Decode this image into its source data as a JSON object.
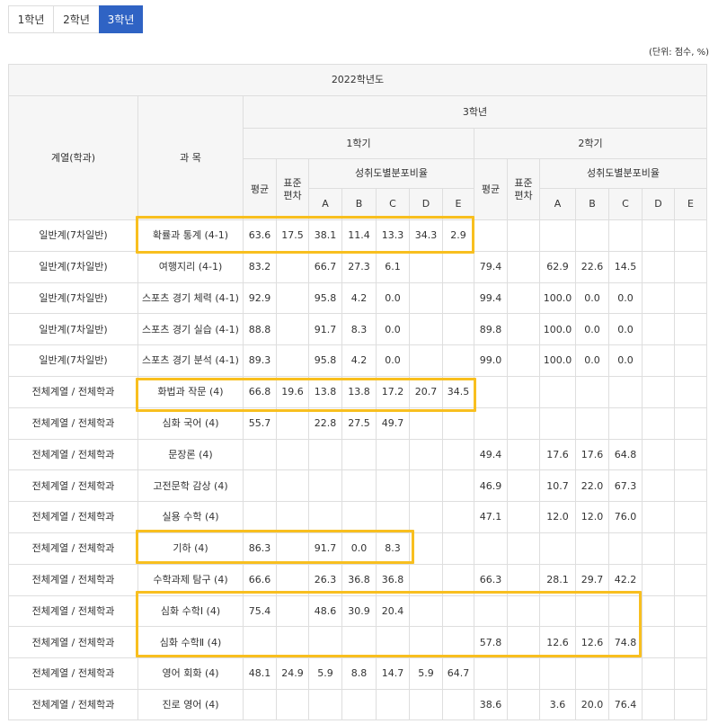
{
  "tabs": [
    {
      "label": "1학년",
      "active": false
    },
    {
      "label": "2학년",
      "active": false
    },
    {
      "label": "3학년",
      "active": true
    }
  ],
  "unit_note": "(단위: 점수, %)",
  "table": {
    "header": {
      "year": "2022학년도",
      "grade": "3학년",
      "dept": "계열(학과)",
      "subject": "과 목",
      "sem1": "1학기",
      "sem2": "2학기",
      "avg": "평균",
      "std_line1": "표준",
      "std_line2": "편차",
      "dist": "성취도별분포비율",
      "grades": [
        "A",
        "B",
        "C",
        "D",
        "E"
      ]
    },
    "rows": [
      {
        "dept": "일반계(7차일반)",
        "subject": "확률과 통계 (4-1)",
        "cells": [
          "63.6",
          "17.5",
          "38.1",
          "11.4",
          "13.3",
          "34.3",
          "2.9",
          "",
          "",
          "",
          "",
          "",
          "",
          ""
        ]
      },
      {
        "dept": "일반계(7차일반)",
        "subject": "여행지리 (4-1)",
        "cells": [
          "83.2",
          "",
          "66.7",
          "27.3",
          "6.1",
          "",
          "",
          "79.4",
          "",
          "62.9",
          "22.6",
          "14.5",
          "",
          ""
        ]
      },
      {
        "dept": "일반계(7차일반)",
        "subject": "스포츠 경기 체력 (4-1)",
        "cells": [
          "92.9",
          "",
          "95.8",
          "4.2",
          "0.0",
          "",
          "",
          "99.4",
          "",
          "100.0",
          "0.0",
          "0.0",
          "",
          ""
        ]
      },
      {
        "dept": "일반계(7차일반)",
        "subject": "스포츠 경기 실습 (4-1)",
        "cells": [
          "88.8",
          "",
          "91.7",
          "8.3",
          "0.0",
          "",
          "",
          "89.8",
          "",
          "100.0",
          "0.0",
          "0.0",
          "",
          ""
        ]
      },
      {
        "dept": "일반계(7차일반)",
        "subject": "스포츠 경기 분석 (4-1)",
        "cells": [
          "89.3",
          "",
          "95.8",
          "4.2",
          "0.0",
          "",
          "",
          "99.0",
          "",
          "100.0",
          "0.0",
          "0.0",
          "",
          ""
        ]
      },
      {
        "dept": "전체계열 / 전체학과",
        "subject": "화법과 작문 (4)",
        "cells": [
          "66.8",
          "19.6",
          "13.8",
          "13.8",
          "17.2",
          "20.7",
          "34.5",
          "",
          "",
          "",
          "",
          "",
          "",
          ""
        ]
      },
      {
        "dept": "전체계열 / 전체학과",
        "subject": "심화 국어 (4)",
        "cells": [
          "55.7",
          "",
          "22.8",
          "27.5",
          "49.7",
          "",
          "",
          "",
          "",
          "",
          "",
          "",
          "",
          ""
        ]
      },
      {
        "dept": "전체계열 / 전체학과",
        "subject": "문장론 (4)",
        "cells": [
          "",
          "",
          "",
          "",
          "",
          "",
          "",
          "49.4",
          "",
          "17.6",
          "17.6",
          "64.8",
          "",
          ""
        ]
      },
      {
        "dept": "전체계열 / 전체학과",
        "subject": "고전문학 감상 (4)",
        "cells": [
          "",
          "",
          "",
          "",
          "",
          "",
          "",
          "46.9",
          "",
          "10.7",
          "22.0",
          "67.3",
          "",
          ""
        ]
      },
      {
        "dept": "전체계열 / 전체학과",
        "subject": "실용 수학 (4)",
        "cells": [
          "",
          "",
          "",
          "",
          "",
          "",
          "",
          "47.1",
          "",
          "12.0",
          "12.0",
          "76.0",
          "",
          ""
        ]
      },
      {
        "dept": "전체계열 / 전체학과",
        "subject": "기하 (4)",
        "cells": [
          "86.3",
          "",
          "91.7",
          "0.0",
          "8.3",
          "",
          "",
          "",
          "",
          "",
          "",
          "",
          "",
          ""
        ]
      },
      {
        "dept": "전체계열 / 전체학과",
        "subject": "수학과제 탐구 (4)",
        "cells": [
          "66.6",
          "",
          "26.3",
          "36.8",
          "36.8",
          "",
          "",
          "66.3",
          "",
          "28.1",
          "29.7",
          "42.2",
          "",
          ""
        ]
      },
      {
        "dept": "전체계열 / 전체학과",
        "subject": "심화 수학Ⅰ (4)",
        "cells": [
          "75.4",
          "",
          "48.6",
          "30.9",
          "20.4",
          "",
          "",
          "",
          "",
          "",
          "",
          "",
          "",
          ""
        ]
      },
      {
        "dept": "전체계열 / 전체학과",
        "subject": "심화 수학Ⅱ (4)",
        "cells": [
          "",
          "",
          "",
          "",
          "",
          "",
          "",
          "57.8",
          "",
          "12.6",
          "12.6",
          "74.8",
          "",
          ""
        ]
      },
      {
        "dept": "전체계열 / 전체학과",
        "subject": "영어 회화 (4)",
        "cells": [
          "48.1",
          "24.9",
          "5.9",
          "8.8",
          "14.7",
          "5.9",
          "64.7",
          "",
          "",
          "",
          "",
          "",
          "",
          ""
        ]
      },
      {
        "dept": "전체계열 / 전체학과",
        "subject": "진로 영어 (4)",
        "cells": [
          "",
          "",
          "",
          "",
          "",
          "",
          "",
          "38.6",
          "",
          "3.6",
          "20.0",
          "76.4",
          "",
          ""
        ]
      }
    ]
  },
  "highlight_color": "#f8bf1f",
  "active_tab_color": "#2f63c4"
}
